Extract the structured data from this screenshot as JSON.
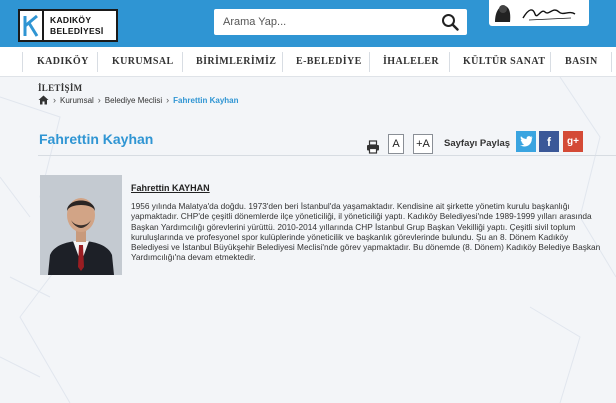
{
  "header": {
    "logo_line1": "KADIKÖY",
    "logo_line2": "BELEDİYESİ",
    "search_placeholder": "Arama Yap..."
  },
  "nav": {
    "items": [
      "KADIKÖY",
      "KURUMSAL",
      "BİRİMLERİMİZ",
      "E-BELEDİYE",
      "İHALELER",
      "KÜLTÜR SANAT",
      "BASIN"
    ],
    "second_row": "İLETİŞİM"
  },
  "breadcrumb": {
    "items": [
      "Kurumsal",
      "Belediye Meclisi",
      "Fahrettin Kayhan"
    ]
  },
  "page": {
    "title": "Fahrettin Kayhan",
    "font_smaller": "A",
    "font_larger": "+A",
    "share_label": "Sayfayı Paylaş",
    "social": {
      "twitter": "t",
      "facebook": "f",
      "google": "g+"
    }
  },
  "profile": {
    "name": "Fahrettin KAYHAN",
    "bio": "1956 yılında Malatya'da doğdu. 1973'den beri İstanbul'da yaşamaktadır. Kendisine ait şirkette yönetim kurulu başkanlığı yapmaktadır. CHP'de çeşitli dönemlerde ilçe yöneticiliği, il yöneticiliği yaptı. Kadıköy Belediyesi'nde 1989-1999 yılları arasında Başkan Yardımcılığı görevlerini yürüttü. 2010-2014 yıllarında CHP İstanbul Grup Başkan Vekilliği yaptı. Çeşitli sivil toplum kuruluşlarında ve profesyonel spor kulüplerinde yöneticilik ve başkanlık görevlerinde bulundu. Şu an 8. Dönem Kadıköy Belediyesi ve İstanbul Büyükşehir Belediyesi Meclisi'nde görev yapmaktadır. Bu dönemde (8. Dönem) Kadıköy Belediye Başkan Yardımcılığı'na devam etmektedir."
  },
  "colors": {
    "brand_blue": "#2f95d3",
    "twitter": "#3aa4e0",
    "facebook": "#3b5898",
    "google": "#d44a36"
  },
  "icons": [
    "search-icon",
    "home-icon",
    "print-icon",
    "twitter-icon",
    "facebook-icon",
    "google-plus-icon"
  ]
}
